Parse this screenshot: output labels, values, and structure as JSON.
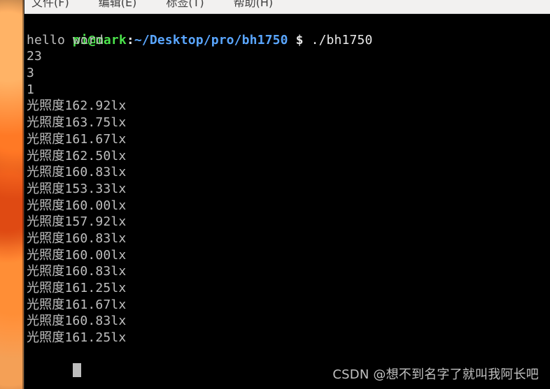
{
  "menubar": {
    "items": [
      {
        "label": "文件(F)"
      },
      {
        "label": "编辑(E)"
      },
      {
        "label": "标签(T)"
      },
      {
        "label": "帮助(H)"
      }
    ]
  },
  "terminal": {
    "prompt": {
      "user_host": "pi@mark",
      "sep": ":",
      "path": "~/Desktop/pro/bh1750",
      "dollar": "$",
      "command": " ./bh1750"
    },
    "lines": [
      "hello word",
      "23",
      "3",
      "1",
      "光照度162.92lx",
      "光照度163.75lx",
      "光照度161.67lx",
      "光照度162.50lx",
      "光照度160.83lx",
      "光照度153.33lx",
      "光照度160.00lx",
      "光照度157.92lx",
      "光照度160.83lx",
      "光照度160.00lx",
      "光照度160.83lx",
      "光照度161.25lx",
      "光照度161.67lx",
      "光照度160.83lx",
      "光照度161.25lx"
    ]
  },
  "watermark": {
    "text": "CSDN @想不到名字了就叫我阿长吧"
  },
  "colors": {
    "terminal_bg": "#000000",
    "terminal_text": "#bfbfbf",
    "prompt_green": "#4be34b",
    "prompt_blue": "#5aa6ff",
    "cursor": "#bdbdbd"
  }
}
